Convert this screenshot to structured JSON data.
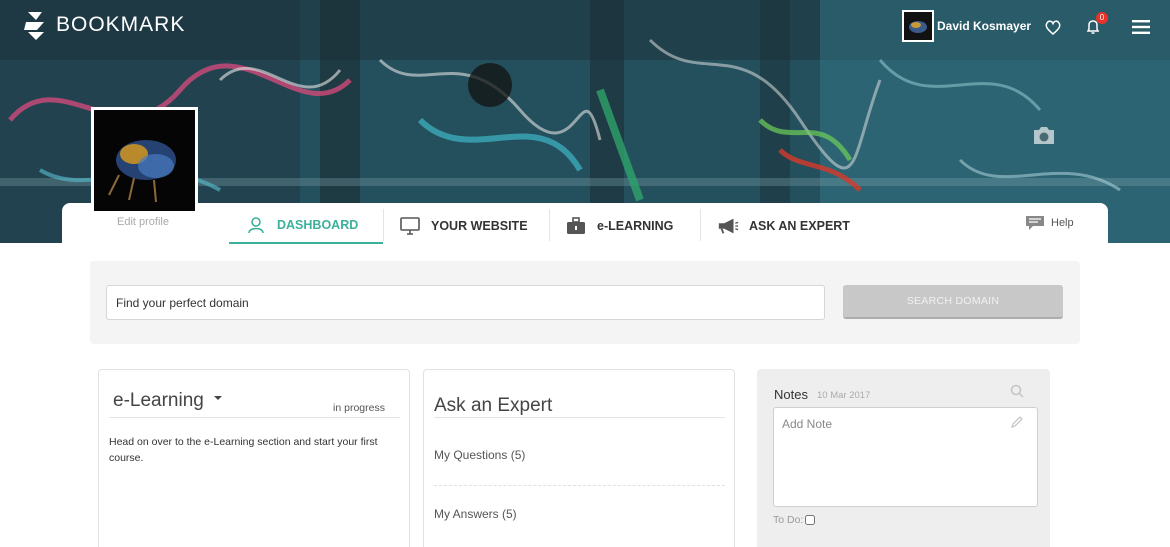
{
  "brand": {
    "name": "BOOKMARK"
  },
  "header": {
    "user_name": "David Kosmayer",
    "notification_count": "0"
  },
  "profile": {
    "edit_label": "Edit profile"
  },
  "tabs": [
    {
      "label": "DASHBOARD",
      "icon": "user-icon",
      "active": true
    },
    {
      "label": "YOUR WEBSITE",
      "icon": "monitor-icon",
      "active": false
    },
    {
      "label": "e-LEARNING",
      "icon": "briefcase-icon",
      "active": false
    },
    {
      "label": "ASK AN EXPERT",
      "icon": "megaphone-icon",
      "active": false
    }
  ],
  "help": {
    "label": "Help"
  },
  "domain_search": {
    "placeholder": "Find your perfect domain",
    "button_label": "SEARCH DOMAIN"
  },
  "elearning_card": {
    "title": "e-Learning",
    "status": "in progress",
    "body": "Head on over to the e-Learning section and start your first course."
  },
  "expert_card": {
    "title": "Ask an Expert",
    "my_questions": "My Questions (5)",
    "my_answers": "My Answers (5)"
  },
  "notes": {
    "title": "Notes",
    "date": "10 Mar 2017",
    "placeholder": "Add Note",
    "todo_label": "To Do:"
  },
  "colors": {
    "accent": "#3bb19b",
    "badge": "#e8332b",
    "button_disabled": "#c8c8c8"
  }
}
